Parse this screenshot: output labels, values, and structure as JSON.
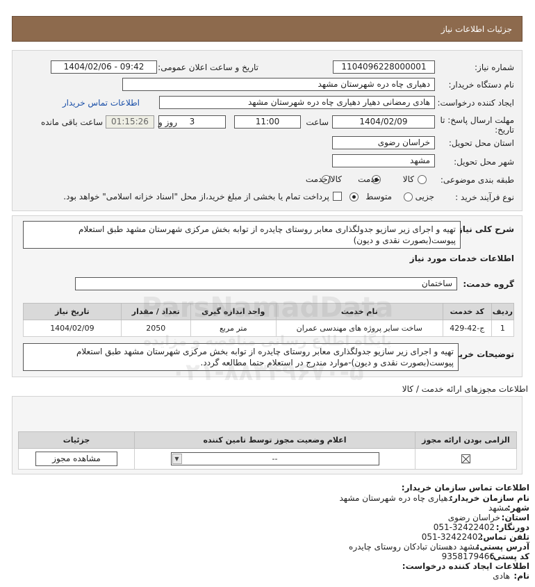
{
  "header": {
    "title": "جزئیات اطلاعات نیاز"
  },
  "form": {
    "need_number_label": "شماره نیاز:",
    "need_number": "1104096228000001",
    "announce_label": "تاریخ و ساعت اعلان عمومی:",
    "announce_value": "1404/02/06 - 09:42",
    "buyer_org_label": "نام دستگاه خریدار:",
    "buyer_org": "دهیاری چاه دره  شهرستان مشهد",
    "creator_label": "ایجاد کننده درخواست:",
    "creator": "هادی رمضانی دهیار دهیاری چاه دره  شهرستان مشهد",
    "contact_link": "اطلاعات تماس خریدار",
    "deadline_label_1": "مهلت ارسال پاسخ: تا",
    "deadline_label_2": "تاریخ:",
    "deadline_date": "1404/02/09",
    "time_label": "ساعت",
    "deadline_time": "11:00",
    "days_value": "3",
    "days_label": "روز و",
    "remaining_time": "01:15:26",
    "remaining_label": "ساعت باقی مانده",
    "province_label": "استان محل تحویل:",
    "province": "خراسان رضوی",
    "city_label": "شهر محل تحویل:",
    "city": "مشهد",
    "category_label": "طبقه بندی موضوعی:",
    "category_options": [
      "کالا",
      "خدمت",
      "کالا/خدمت"
    ],
    "category_selected": "خدمت",
    "process_label": "نوع فرآیند خرید :",
    "process_options": [
      "جزیی",
      "متوسط"
    ],
    "process_selected": "متوسط",
    "payment_note": "پرداخت تمام یا بخشی از مبلغ خرید،از محل \"اسناد خزانه اسلامی\" خواهد بود."
  },
  "description": {
    "label": "شرح کلی نیاز:",
    "text": "تهیه و اجرای زیر سازیو جدولگذاری معابر روستای چایدره از توابه بخش مرکزی شهرستان مشهد طبق استعلام پیوست(بصورت نقدی و دیون)"
  },
  "services": {
    "section_title": "اطلاعات خدمات مورد نیاز",
    "group_label": "گروه خدمت:",
    "group_value": "ساختمان",
    "columns": [
      "ردیف",
      "کد خدمت",
      "نام خدمت",
      "واحد اندازه گیری",
      "تعداد / مقدار",
      "تاریخ نیاز"
    ],
    "rows": [
      [
        "1",
        "ج-42-429",
        "ساخت سایر پروژه های مهندسی عمران",
        "متر مربع",
        "2050",
        "1404/02/09"
      ]
    ]
  },
  "buyer_notes": {
    "label": "توضیحات خریدار:",
    "text": "تهیه و اجرای زیر سازیو جدولگذاری معابر روستای چایدره از توابه بخش مرکزی شهرستان مشهد طبق استعلام پیوست(بصورت نقدی و دیون)-موارد مندرج در استعلام حتما مطالعه گردد."
  },
  "permits": {
    "title": "اطلاعات مجوزهای ارائه خدمت / کالا",
    "columns": [
      "الزامی بودن ارائه مجوز",
      "اعلام وضعیت مجوز توسط تامین کننده",
      "جزئیات"
    ],
    "select_value": "--",
    "view_button": "مشاهده مجوز"
  },
  "contact": {
    "title": "اطلاعات تماس سازمان خریدار:",
    "org_label": "نام سازمان خریدار:",
    "org_value": "دهیاری چاه دره شهرستان مشهد",
    "city_label": "شهر:",
    "city_value": "مشهد",
    "province_label": "استان:",
    "province_value": "خراسان رضوی",
    "fax_label": "دورنگار:",
    "fax_value": "051-32422402",
    "phone_label": "تلفن تماس:",
    "phone_value": "051-32422402",
    "address_label": "آدرس پستی:",
    "address_value": "مشهد دهستان تبادکان روستای چایدره",
    "postal_label": "کد پستی:",
    "postal_value": "9358179466",
    "creator_title": "اطلاعات ایجاد کننده درخواست:",
    "name_label": "نام:",
    "name_value": "هادی"
  },
  "watermark": {
    "site": "ParsNamadData",
    "tagline": "پایگاه اطلاع رسانی مناقصه و مزایده",
    "phone": "۰۲۱-۸۸۳۴۹۶۷۰-۵"
  }
}
